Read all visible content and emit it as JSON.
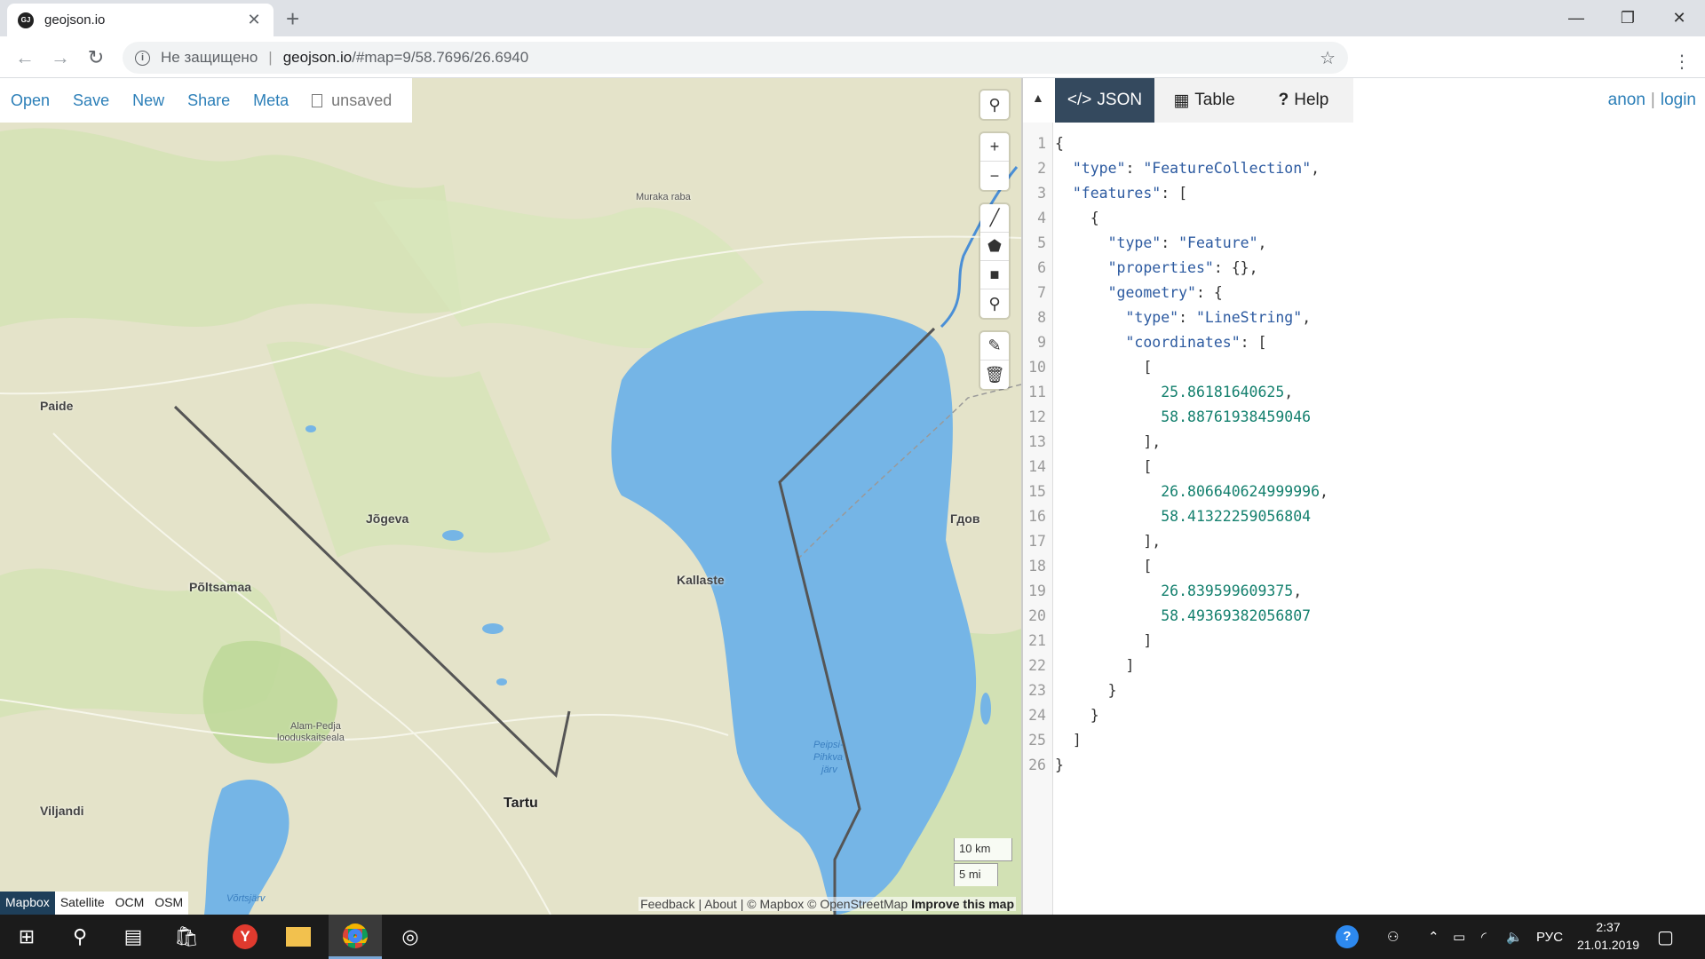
{
  "browser": {
    "tab_title": "geojson.io",
    "tab_favicon": "GJ",
    "newtab": "+",
    "insecure_label": "Не защищено",
    "host": "geojson.io",
    "path": "/#map=9/58.7696/26.6940",
    "star_icon": "star-icon"
  },
  "menu": {
    "open": "Open",
    "save": "Save",
    "new": "New",
    "share": "Share",
    "meta": "Meta",
    "status": "unsaved"
  },
  "map_labels": {
    "muraka": "Muraka raba",
    "paide": "Paide",
    "jogeva": "Jõgeva",
    "poltsamaa": "Põltsamaa",
    "kallaste": "Kallaste",
    "gdov": "Гдов",
    "alam1": "Alam-Pedja",
    "alam2": "looduskaitseala",
    "tartu": "Tartu",
    "viljandi": "Viljandi",
    "peipsi1": "Peipsi-",
    "peipsi2": "Pihkva",
    "peipsi3": "järv",
    "vortsjarv": "Võrtsjärv"
  },
  "layers": [
    "Mapbox",
    "Satellite",
    "OCM",
    "OSM"
  ],
  "scale": {
    "km": "10 km",
    "mi": "5 mi"
  },
  "attribution": {
    "feedback": "Feedback",
    "about": "About",
    "mapbox": "© Mapbox",
    "osm": "© OpenStreetMap",
    "improve": "Improve this map"
  },
  "pane": {
    "collapse_icon": "caret-up-icon",
    "tabs": {
      "json": "JSON",
      "table": "Table",
      "help": "Help"
    },
    "user": {
      "anon": "anon",
      "sep": "|",
      "login": "login"
    }
  },
  "geojson": {
    "type": "FeatureCollection",
    "feature_type": "Feature",
    "geometry_type": "LineString",
    "coordinates": [
      [
        "25.86181640625",
        "58.88761938459046"
      ],
      [
        "26.806640624999996",
        "58.41322259056804"
      ],
      [
        "26.839599609375",
        "58.49369382056807"
      ]
    ]
  },
  "taskbar": {
    "lang": "РУС",
    "time": "2:37",
    "date": "21.01.2019"
  },
  "colors": {
    "accent": "#2c7fb8",
    "tab_active": "#34495e",
    "water": "#75b5e6",
    "land": "#e4e3c9",
    "forest": "#cfe0b1",
    "line": "#555555"
  }
}
